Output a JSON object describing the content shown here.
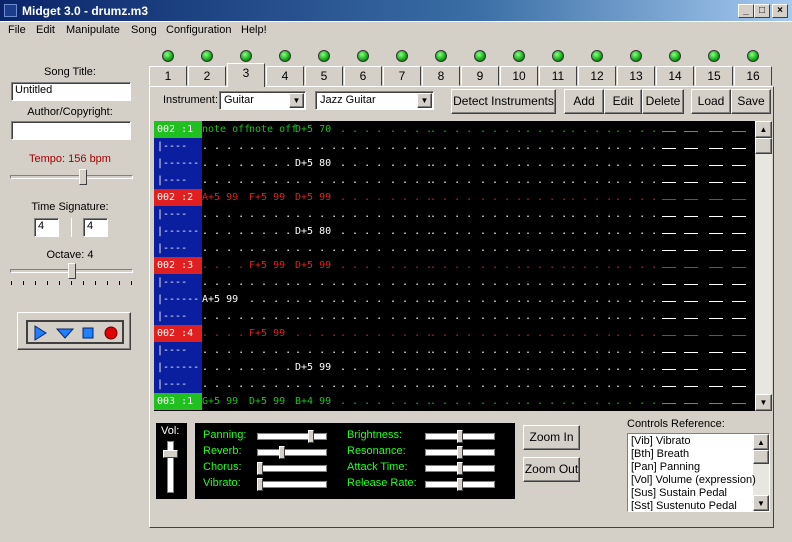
{
  "window": {
    "title": "Midget 3.0 - drumz.m3",
    "min_label": "_",
    "max_label": "□",
    "close_label": "×"
  },
  "menu": [
    "File",
    "Edit",
    "Manipulate",
    "Song",
    "Configuration",
    "Help!"
  ],
  "left_panel": {
    "song_title_label": "Song Title:",
    "song_title_value": "Untitled",
    "author_label": "Author/Copyright:",
    "author_value": "",
    "tempo_label": "Tempo: 156 bpm",
    "tempo_color": "#a00000",
    "tempo_level": 0.6,
    "time_sig_label": "Time Signature:",
    "time_sig_num": "4",
    "time_sig_den": "4",
    "octave_label": "Octave: 4",
    "octave_level": 0.5
  },
  "tabs": [
    "1",
    "2",
    "3",
    "4",
    "5",
    "6",
    "7",
    "8",
    "9",
    "10",
    "11",
    "12",
    "13",
    "14",
    "15",
    "16"
  ],
  "active_tab": "3",
  "toolbar": {
    "instrument_label": "Instrument:",
    "instrument_value": "Guitar",
    "patch_value": "Jazz Guitar",
    "detect": "Detect Instruments",
    "add": "Add",
    "edit": "Edit",
    "delete": "Delete",
    "load": "Load",
    "save": "Save"
  },
  "colors": {
    "green": "#20c020",
    "red": "#e02020",
    "blue": "#0a1fa0",
    "white": "#ffffff",
    "grid_bg": "#000000"
  },
  "pattern_rows": [
    {
      "label": "002 :1",
      "kind": "green",
      "c1": "note off",
      "c2": "note off",
      "c3": "D+5 70",
      "c1k": "green",
      "c2k": "green",
      "c3k": "green"
    },
    {
      "label": "|----",
      "kind": "blue",
      "c1": ". . . .",
      "c2": ". . . .",
      "c3": ". . . .",
      "c1k": "white",
      "c2k": "white",
      "c3k": "white"
    },
    {
      "label": "|------",
      "kind": "blue",
      "c1": ". . . .",
      "c2": ". . . .",
      "c3": "D+5 80",
      "c1k": "white",
      "c2k": "white",
      "c3k": "white"
    },
    {
      "label": "|----",
      "kind": "blue",
      "c1": ". . . .",
      "c2": ". . . .",
      "c3": ". . . .",
      "c1k": "white",
      "c2k": "white",
      "c3k": "white"
    },
    {
      "label": "002 :2",
      "kind": "red",
      "c1": "A+5 99",
      "c2": "F+5 99",
      "c3": "D+5 99",
      "c1k": "red",
      "c2k": "red",
      "c3k": "red"
    },
    {
      "label": "|----",
      "kind": "blue",
      "c1": ". . . .",
      "c2": ". . . .",
      "c3": ". . . .",
      "c1k": "white",
      "c2k": "white",
      "c3k": "white"
    },
    {
      "label": "|------",
      "kind": "blue",
      "c1": ". . . .",
      "c2": ". . . .",
      "c3": "D+5 80",
      "c1k": "white",
      "c2k": "white",
      "c3k": "white"
    },
    {
      "label": "|----",
      "kind": "blue",
      "c1": ". . . .",
      "c2": ". . . .",
      "c3": ". . . .",
      "c1k": "white",
      "c2k": "white",
      "c3k": "white"
    },
    {
      "label": "002 :3",
      "kind": "red",
      "c1": ". . . .",
      "c2": "F+5 99",
      "c3": "D+5 99",
      "c1k": "red",
      "c2k": "red",
      "c3k": "red"
    },
    {
      "label": "|----",
      "kind": "blue",
      "c1": ". . . .",
      "c2": ". . . .",
      "c3": ". . . .",
      "c1k": "white",
      "c2k": "white",
      "c3k": "white"
    },
    {
      "label": "|------",
      "kind": "blue",
      "c1": "A+5 99",
      "c2": ". . . .",
      "c3": ". . . .",
      "c1k": "white",
      "c2k": "white",
      "c3k": "white"
    },
    {
      "label": "|----",
      "kind": "blue",
      "c1": ". . . .",
      "c2": ". . . .",
      "c3": ". . . .",
      "c1k": "white",
      "c2k": "white",
      "c3k": "white"
    },
    {
      "label": "002 :4",
      "kind": "red",
      "c1": ". . . .",
      "c2": "F+5 99",
      "c3": ". . . .",
      "c1k": "red",
      "c2k": "red",
      "c3k": "red"
    },
    {
      "label": "|----",
      "kind": "blue",
      "c1": ". . . .",
      "c2": ". . . .",
      "c3": ". . . .",
      "c1k": "white",
      "c2k": "white",
      "c3k": "white"
    },
    {
      "label": "|------",
      "kind": "blue",
      "c1": ". . . .",
      "c2": ". . . .",
      "c3": "D+5 99",
      "c1k": "white",
      "c2k": "white",
      "c3k": "white"
    },
    {
      "label": "|----",
      "kind": "blue",
      "c1": ". . . .",
      "c2": ". . . .",
      "c3": ". . . .",
      "c1k": "white",
      "c2k": "white",
      "c3k": "white"
    },
    {
      "label": "003 :1",
      "kind": "green",
      "c1": "G+5 99",
      "c2": "D+5 99",
      "c3": "B+4 99",
      "c1k": "green",
      "c2k": "green",
      "c3k": "green"
    }
  ],
  "empty_cell": ". . . .",
  "vol_label": "Vol:",
  "vol_level": 0.8,
  "fx_left": [
    {
      "label": "Panning:",
      "level": 0.8
    },
    {
      "label": "Reverb:",
      "level": 0.35
    },
    {
      "label": "Chorus:",
      "level": 0.0
    },
    {
      "label": "Vibrato:",
      "level": 0.0
    }
  ],
  "fx_right": [
    {
      "label": "Brightness:",
      "level": 0.5
    },
    {
      "label": "Resonance:",
      "level": 0.5
    },
    {
      "label": "Attack Time:",
      "level": 0.5
    },
    {
      "label": "Release Rate:",
      "level": 0.5
    }
  ],
  "zoom_in": "Zoom In",
  "zoom_out": "Zoom Out",
  "controls_ref_label": "Controls Reference:",
  "controls_ref": [
    "[Vib] Vibrato",
    "[Bth] Breath",
    "[Pan] Panning",
    "[Vol] Volume (expression)",
    "[Sus] Sustain Pedal",
    "[Sst] Sustenuto Pedal"
  ]
}
